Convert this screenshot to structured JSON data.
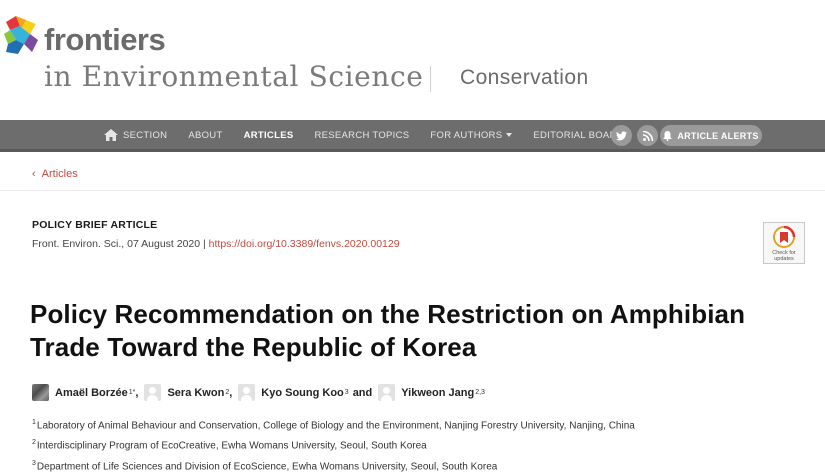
{
  "brand": {
    "logo_text": "frontiers",
    "journal_name": "in Environmental Science",
    "section_name": "Conservation"
  },
  "nav": {
    "items": [
      {
        "label": "SECTION",
        "icon": "home-icon"
      },
      {
        "label": "ABOUT"
      },
      {
        "label": "ARTICLES",
        "active": true
      },
      {
        "label": "RESEARCH TOPICS"
      },
      {
        "label": "FOR AUTHORS",
        "dropdown": true
      },
      {
        "label": "EDITORIAL BOARD"
      }
    ],
    "social": [
      "twitter-icon",
      "rss-icon"
    ],
    "alerts_label": "ARTICLE ALERTS"
  },
  "breadcrumb": {
    "label": "Articles"
  },
  "article": {
    "type": "POLICY BRIEF ARTICLE",
    "citation": "Front. Environ. Sci., 07 August 2020 | ",
    "doi": "https://doi.org/10.3389/fenvs.2020.00129",
    "check_updates_label": "Check for updates",
    "title": "Policy Recommendation on the Restriction on Amphibian Trade Toward the Republic of Korea",
    "authors": [
      {
        "name": "Amaël Borzée",
        "sup": "1*"
      },
      {
        "name": "Sera Kwon",
        "sup": "2"
      },
      {
        "name": "Kyo Soung Koo",
        "sup": "3"
      },
      {
        "name": "Yikweon Jang",
        "sup": "2,3"
      }
    ],
    "and_word": "and",
    "affiliations": [
      {
        "num": "1",
        "text": "Laboratory of Animal Behaviour and Conservation, College of Biology and the Environment, Nanjing Forestry University, Nanjing, China"
      },
      {
        "num": "2",
        "text": "Interdisciplinary Program of EcoCreative, Ewha Womans University, Seoul, South Korea"
      },
      {
        "num": "3",
        "text": "Department of Life Sciences and Division of EcoScience, Ewha Womans University, Seoul, South Korea"
      }
    ]
  },
  "colors": {
    "nav_bg": "#6d6d6d",
    "link": "#c14a3e",
    "logo_text": "#6b6b6b"
  }
}
